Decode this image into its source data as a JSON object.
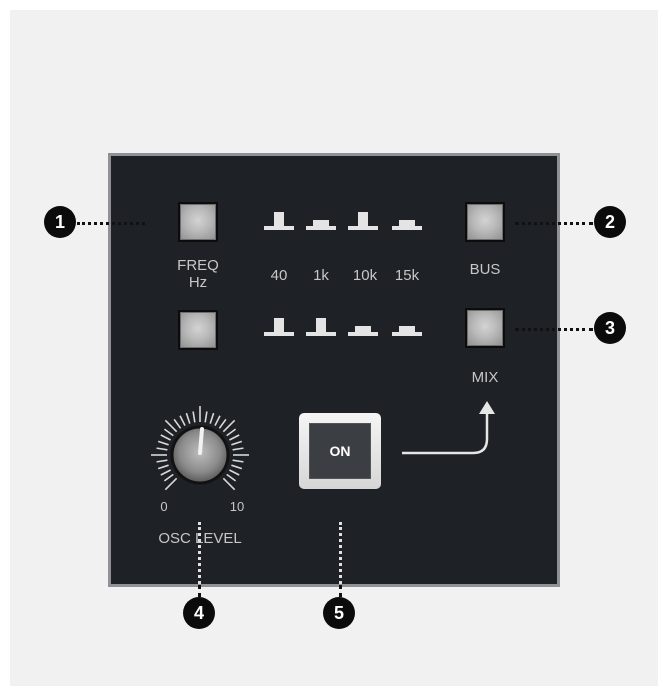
{
  "callouts": [
    "1",
    "2",
    "3",
    "4",
    "5"
  ],
  "labels": {
    "freq_line1": "FREQ",
    "freq_line2": "Hz",
    "bus": "BUS",
    "mix": "MIX",
    "osc_level": "OSC LEVEL",
    "knob_min": "0",
    "knob_max": "10",
    "on": "ON"
  },
  "frequencies": [
    "40",
    "1k",
    "10k",
    "15k"
  ],
  "indicator_rows": {
    "row1_active": [
      true,
      false,
      true,
      false
    ],
    "row2_active": [
      true,
      true,
      false,
      false
    ]
  },
  "colors": {
    "panel": "#1e2125",
    "panel_border": "#8f9194",
    "button_face": "#b8b8b8",
    "text": "#c7c7c7",
    "callout": "#0b0b0b"
  }
}
